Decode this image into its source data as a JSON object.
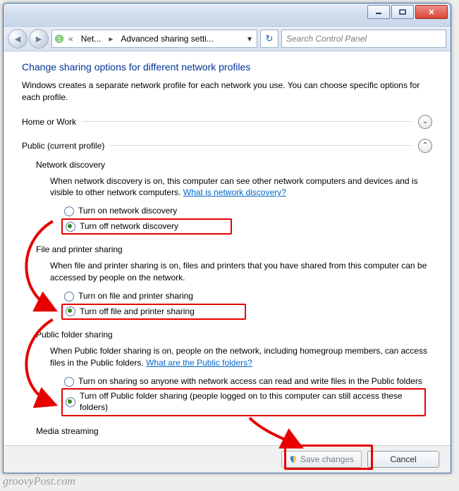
{
  "titlebar": {},
  "breadcrumb": {
    "seg1": "Net...",
    "seg2": "Advanced sharing setti..."
  },
  "search": {
    "placeholder": "Search Control Panel"
  },
  "heading": "Change sharing options for different network profiles",
  "description": "Windows creates a separate network profile for each network you use. You can choose specific options for each profile.",
  "sections": {
    "home": {
      "title": "Home or Work"
    },
    "public": {
      "title": "Public (current profile)"
    }
  },
  "netdisc": {
    "heading": "Network discovery",
    "desc": "When network discovery is on, this computer can see other network computers and devices and is visible to other network computers. ",
    "link": "What is network discovery?",
    "on": "Turn on network discovery",
    "off": "Turn off network discovery"
  },
  "fileprint": {
    "heading": "File and printer sharing",
    "desc": "When file and printer sharing is on, files and printers that you have shared from this computer can be accessed by people on the network.",
    "on": "Turn on file and printer sharing",
    "off": "Turn off file and printer sharing"
  },
  "publicfolder": {
    "heading": "Public folder sharing",
    "desc": "When Public folder sharing is on, people on the network, including homegroup members, can access files in the Public folders. ",
    "link": "What are the Public folders?",
    "on": "Turn on sharing so anyone with network access can read and write files in the Public folders",
    "off": "Turn off Public folder sharing (people logged on to this computer can still access these folders)"
  },
  "media": {
    "heading": "Media streaming"
  },
  "buttons": {
    "save": "Save changes",
    "cancel": "Cancel"
  },
  "watermark": "groovyPost.com"
}
